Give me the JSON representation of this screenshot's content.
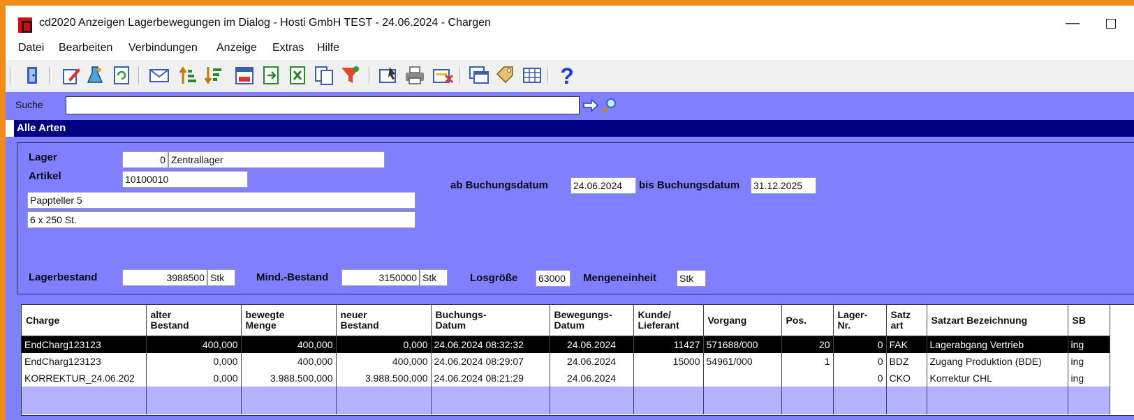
{
  "window": {
    "title": "cd2020 Anzeigen Lagerbewegungen im Dialog - Hosti GmbH TEST - 24.06.2024 - Chargen",
    "minimize_glyph": "—"
  },
  "menu": [
    "Datei",
    "Bearbeiten",
    "Verbindungen",
    "Anzeige",
    "Extras",
    "Hilfe"
  ],
  "toolbar": {
    "icons": [
      "exit-door-icon",
      "edit-pencil-icon",
      "chemistry-flask-icon",
      "refresh-icon",
      "envelope-icon",
      "sort-ascending-icon",
      "sort-descending-icon",
      "calendar-123-icon",
      "export-green-icon",
      "excel-export-icon",
      "copy-pages-icon",
      "filter-funnel-icon",
      "pointer-card-icon",
      "printer-icon",
      "delete-record-icon",
      "windows-icon",
      "tags-icon",
      "grid-icon",
      "help-question-icon"
    ]
  },
  "search": {
    "label": "Suche",
    "value": ""
  },
  "section_title": "Alle Arten",
  "filters": {
    "lager_label": "Lager",
    "lager_nr": "0",
    "lager_name": "Zentrallager",
    "artikel_label": "Artikel",
    "artikel_nr": "10100010",
    "artikel_text1": "Pappteller 5",
    "artikel_text2": "6 x 250 St.",
    "ab_label": "ab Buchungsdatum",
    "ab_date": "24.06.2024",
    "bis_label": "bis Buchungsdatum",
    "bis_date": "31.12.2025",
    "lagerbestand_label": "Lagerbestand",
    "lagerbestand_value": "3988500",
    "lagerbestand_unit": "Stk",
    "mind_label": "Mind.-Bestand",
    "mind_value": "3150000",
    "mind_unit": "Stk",
    "los_label": "Losgröße",
    "los_value": "63000",
    "me_label": "Mengeneinheit",
    "me_value": "Stk"
  },
  "table": {
    "headers": [
      [
        "Charge",
        ""
      ],
      [
        "alter",
        "Bestand"
      ],
      [
        "bewegte",
        "Menge"
      ],
      [
        "neuer",
        "Bestand"
      ],
      [
        "Buchungs-",
        "Datum"
      ],
      [
        "Bewegungs-",
        "Datum"
      ],
      [
        "Kunde/",
        "Lieferant"
      ],
      [
        "Vorgang",
        ""
      ],
      [
        "Pos.",
        ""
      ],
      [
        "Lager-",
        "Nr."
      ],
      [
        "Satz",
        "art"
      ],
      [
        "Satzart Bezeichnung",
        ""
      ],
      [
        "SB",
        ""
      ]
    ],
    "rows": [
      [
        "EndCharg123123",
        "400,000",
        "400,000",
        "0,000",
        "24.06.2024 08:32:32",
        "24.06.2024",
        "11427",
        "571688/000",
        "20",
        "0",
        "FAK",
        "Lagerabgang Vertrieb",
        "ing"
      ],
      [
        "EndCharg123123",
        "0,000",
        "400,000",
        "400,000",
        "24.06.2024 08:29:07",
        "24.06.2024",
        "15000",
        "54961/000",
        "1",
        "0",
        "BDZ",
        "Zugang Produktion (BDE)",
        "ing"
      ],
      [
        "KORREKTUR_24.06.202",
        "0,000",
        "3.988.500,000",
        "3.988.500,000",
        "24.06.2024 08:21:29",
        "24.06.2024",
        "",
        "",
        "",
        "0",
        "CKO",
        "Korrektur CHL",
        "ing"
      ]
    ]
  }
}
